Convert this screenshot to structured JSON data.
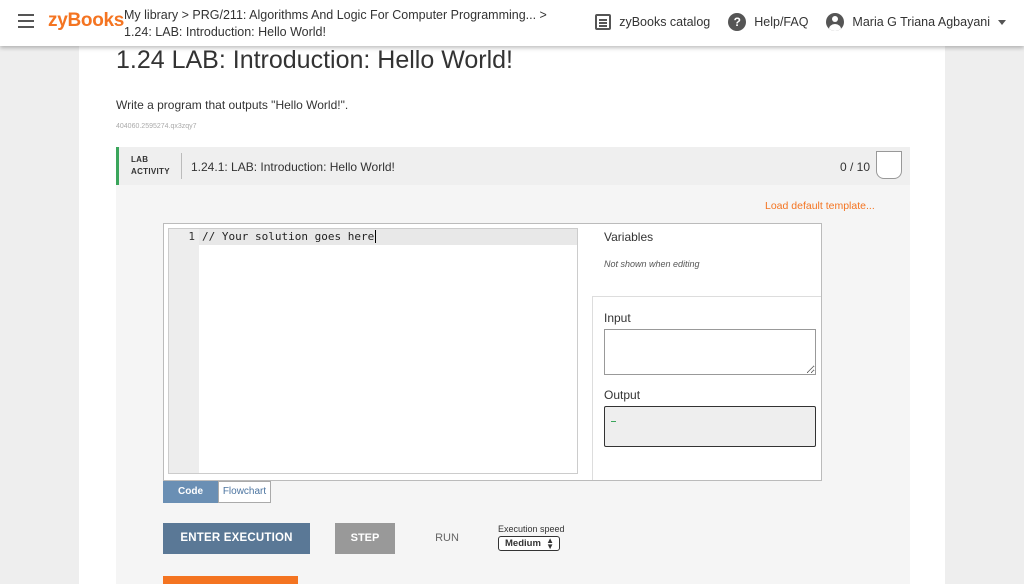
{
  "header": {
    "logo": "zyBooks",
    "breadcrumb_line1": "My library > PRG/211: Algorithms And Logic For Computer Programming... >",
    "breadcrumb_line2": "1.24: LAB: Introduction: Hello World!",
    "catalog": "zyBooks catalog",
    "help": "Help/FAQ",
    "user": "Maria G Triana Agbayani"
  },
  "section": {
    "title": "1.24 LAB: Introduction: Hello World!",
    "prompt": "Write a program that outputs \"Hello World!\".",
    "code_id": "404060.2595274.qx3zqy7"
  },
  "lab": {
    "tag_line1": "LAB",
    "tag_line2": "ACTIVITY",
    "title": "1.24.1: LAB: Introduction: Hello World!",
    "score": "0 / 10",
    "load_template": "Load default template..."
  },
  "editor": {
    "line_number": "1",
    "code": "// Your solution goes here"
  },
  "panel": {
    "variables_title": "Variables",
    "variables_note": "Not shown when editing",
    "input_label": "Input",
    "output_label": "Output"
  },
  "tabs": {
    "code": "Code",
    "flowchart": "Flowchart"
  },
  "controls": {
    "enter_execution": "ENTER EXECUTION",
    "step": "STEP",
    "run": "RUN",
    "speed_label": "Execution speed",
    "speed_value": "Medium"
  },
  "colors": {
    "brand": "#f47421",
    "lab_accent": "#3aa55b",
    "primary_button": "#5a7896"
  }
}
